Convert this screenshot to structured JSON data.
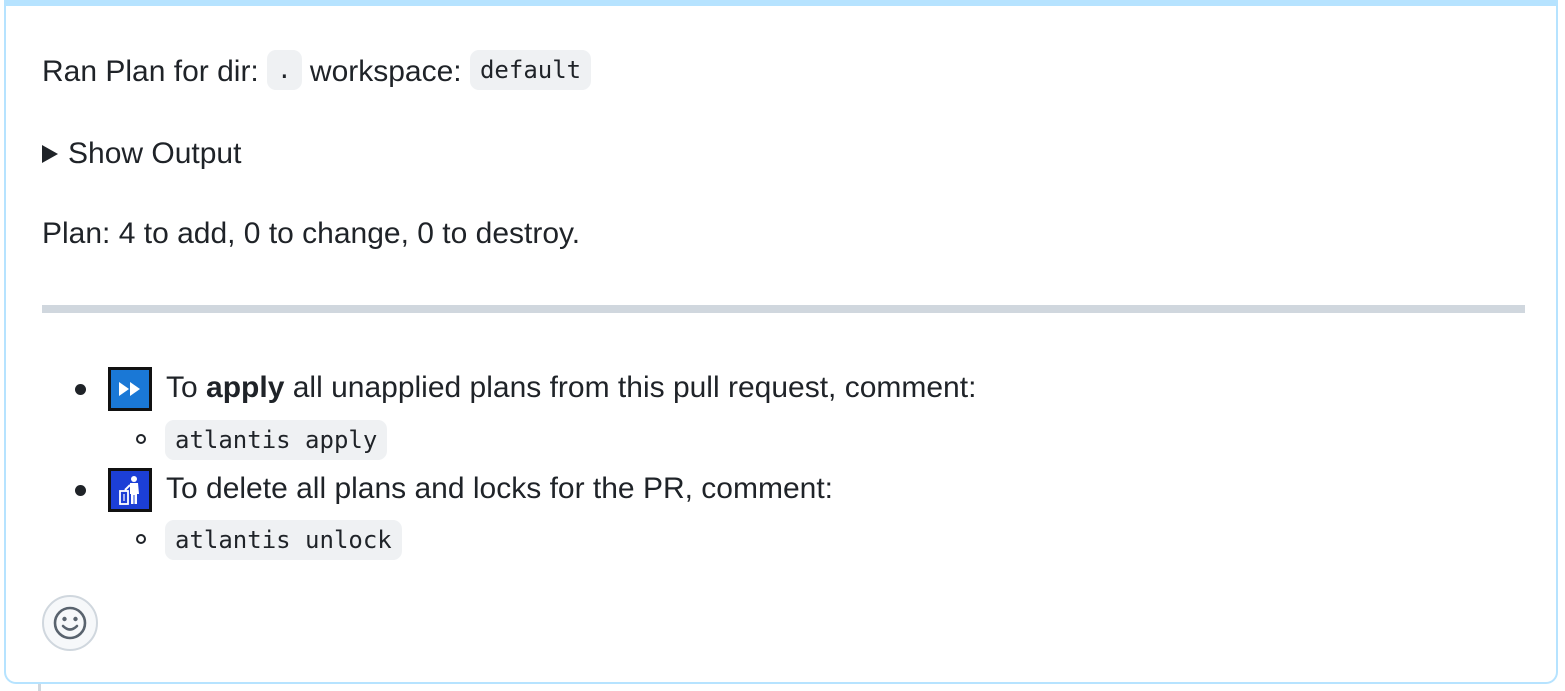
{
  "ran_line": {
    "prefix": "Ran Plan for dir: ",
    "dir": ".",
    "workspace_label": " workspace: ",
    "workspace": "default"
  },
  "details": {
    "summary": "Show Output"
  },
  "plan_summary": "Plan: 4 to add, 0 to change, 0 to destroy.",
  "actions": [
    {
      "icon": "fast-forward-icon",
      "text_pre": "To ",
      "text_bold": "apply",
      "text_post": " all unapplied plans from this pull request, comment:",
      "command": "atlantis apply"
    },
    {
      "icon": "litter-in-bin-icon",
      "text": "To delete all plans and locks for the PR, comment:",
      "command": "atlantis unlock"
    }
  ],
  "colors": {
    "card_border": "#b6e3ff",
    "code_bg": "#eff1f3",
    "apply_icon_bg": "#1a78d6",
    "trash_icon_bg": "#1c3fd6"
  },
  "reaction": {
    "icon": "smiley-icon"
  }
}
